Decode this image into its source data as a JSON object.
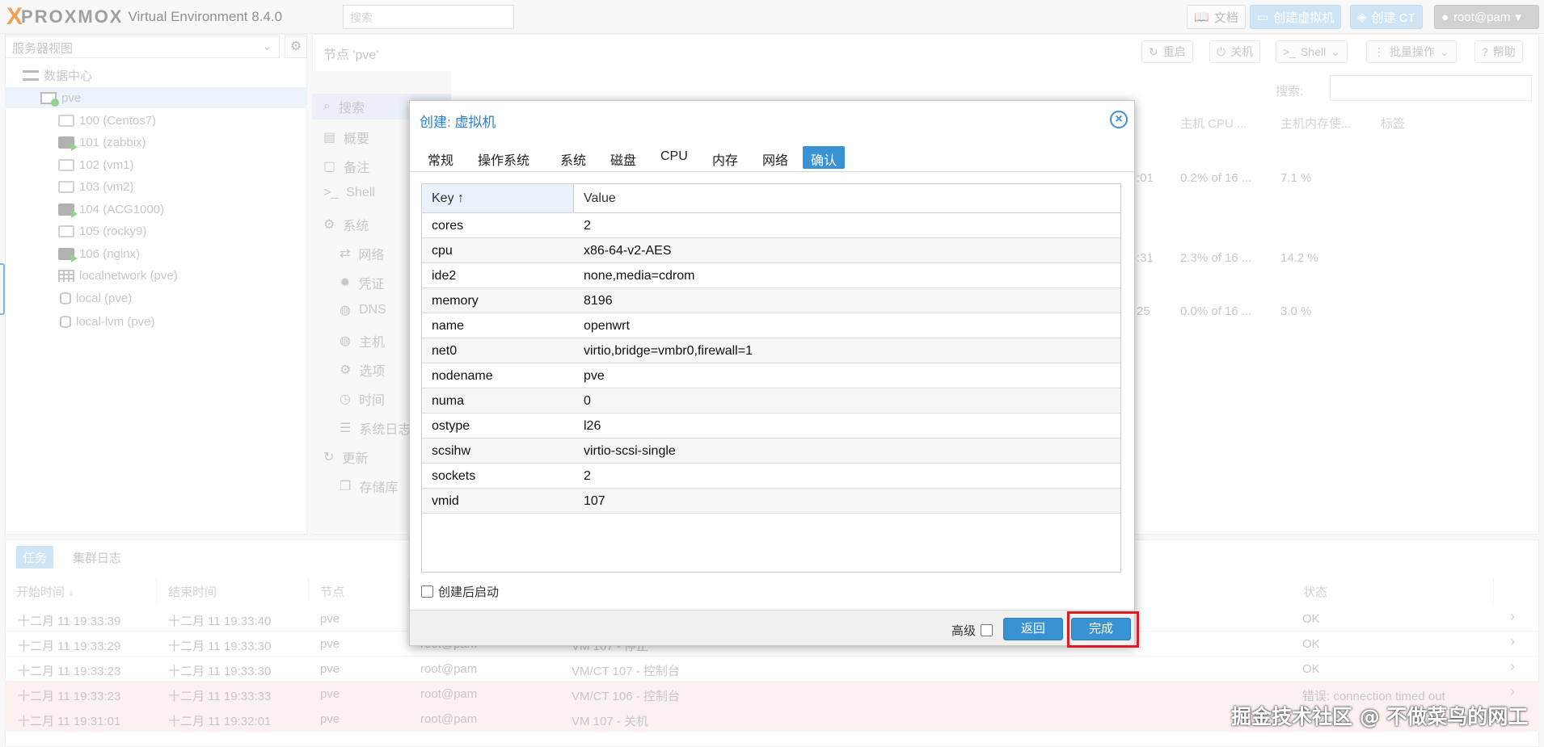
{
  "app": {
    "logo_x": "X",
    "logo_word": "PROXMOX",
    "version": "Virtual Environment 8.4.0",
    "search_placeholder": "搜索",
    "docs_label": "文档",
    "create_vm_label": "创建虚拟机",
    "create_ct_label": "创建 CT",
    "user_label": "root@pam"
  },
  "tree": {
    "view_label": "服务器视图",
    "items": [
      {
        "label": "数据中心",
        "icon": "datacenter-icon"
      },
      {
        "label": "pve",
        "icon": "node-icon"
      },
      {
        "label": "100 (Centos7)",
        "icon": "vm-icon"
      },
      {
        "label": "101 (zabbix)",
        "icon": "vm-running-icon"
      },
      {
        "label": "102 (vm1)",
        "icon": "vm-icon"
      },
      {
        "label": "103 (vm2)",
        "icon": "vm-icon"
      },
      {
        "label": "104 (ACG1000)",
        "icon": "vm-running-icon"
      },
      {
        "label": "105 (rocky9)",
        "icon": "vm-icon"
      },
      {
        "label": "106 (nginx)",
        "icon": "vm-running-icon"
      },
      {
        "label": "localnetwork (pve)",
        "icon": "network-grid-icon"
      },
      {
        "label": "local (pve)",
        "icon": "storage-icon"
      },
      {
        "label": "local-lvm (pve)",
        "icon": "storage-icon"
      }
    ]
  },
  "node": {
    "title": "节点 'pve'",
    "reboot_label": "重启",
    "shutdown_label": "关机",
    "shell_label": "Shell",
    "bulk_label": "批量操作",
    "help_label": "帮助",
    "search_label": "搜索:",
    "nav": [
      {
        "label": "搜索",
        "icon": "search-icon"
      },
      {
        "label": "概要",
        "icon": "summary-icon"
      },
      {
        "label": "备注",
        "icon": "notes-icon"
      },
      {
        "label": "Shell",
        "icon": "terminal-icon"
      },
      {
        "label": "系统",
        "icon": "gears-icon"
      },
      {
        "label": "网络",
        "icon": "network-icon"
      },
      {
        "label": "凭证",
        "icon": "certificate-icon"
      },
      {
        "label": "DNS",
        "icon": "globe-icon"
      },
      {
        "label": "主机",
        "icon": "globe-icon"
      },
      {
        "label": "选项",
        "icon": "gear-icon"
      },
      {
        "label": "时间",
        "icon": "clock-icon"
      },
      {
        "label": "系统日志",
        "icon": "list-icon"
      },
      {
        "label": "更新",
        "icon": "refresh-icon"
      },
      {
        "label": "存储库",
        "icon": "repository-icon"
      }
    ],
    "grid_headers": {
      "cpu": "主机 CPU ...",
      "mem": "主机内存使...",
      "tags": "标签"
    },
    "grid_rows": [
      {
        "uptime": ":01",
        "cpu": "0.2% of 16 ...",
        "mem": "7.1 %"
      },
      {
        "uptime": ":31",
        "cpu": "2.3% of 16 ...",
        "mem": "14.2 %"
      },
      {
        "uptime": "25",
        "cpu": "0.0% of 16 ...",
        "mem": "3.0 %"
      }
    ]
  },
  "tasks": {
    "tab_tasks": "任务",
    "tab_cluster_log": "集群日志",
    "headers": {
      "start": "开始时间",
      "end": "结束时间",
      "node": "节点",
      "status": "状态"
    },
    "rows": [
      {
        "start": "十二月 11 19:33:39",
        "end": "十二月 11 19:33:40",
        "node": "pve",
        "user": "",
        "desc": "",
        "status": "OK",
        "error": false
      },
      {
        "start": "十二月 11 19:33:29",
        "end": "十二月 11 19:33:30",
        "node": "pve",
        "user": "root@pam",
        "desc": "VM 107 - 停止",
        "status": "OK",
        "error": false
      },
      {
        "start": "十二月 11 19:33:23",
        "end": "十二月 11 19:33:30",
        "node": "pve",
        "user": "root@pam",
        "desc": "VM/CT 107 - 控制台",
        "status": "OK",
        "error": false
      },
      {
        "start": "十二月 11 19:33:23",
        "end": "十二月 11 19:33:33",
        "node": "pve",
        "user": "root@pam",
        "desc": "VM/CT 106 - 控制台",
        "status": "错误: connection timed out",
        "error": true
      },
      {
        "start": "十二月 11 19:31:01",
        "end": "十二月 11 19:32:01",
        "node": "pve",
        "user": "root@pam",
        "desc": "VM 107 - 关机",
        "status": "",
        "error": true
      }
    ]
  },
  "dialog": {
    "title": "创建: 虚拟机",
    "tabs": [
      "常规",
      "操作系统",
      "系统",
      "磁盘",
      "CPU",
      "内存",
      "网络",
      "确认"
    ],
    "active_tab": "确认",
    "key_header": "Key ↑",
    "value_header": "Value",
    "rows": [
      {
        "key": "cores",
        "value": "2"
      },
      {
        "key": "cpu",
        "value": "x86-64-v2-AES"
      },
      {
        "key": "ide2",
        "value": "none,media=cdrom"
      },
      {
        "key": "memory",
        "value": "8196"
      },
      {
        "key": "name",
        "value": "openwrt"
      },
      {
        "key": "net0",
        "value": "virtio,bridge=vmbr0,firewall=1"
      },
      {
        "key": "nodename",
        "value": "pve"
      },
      {
        "key": "numa",
        "value": "0"
      },
      {
        "key": "ostype",
        "value": "l26"
      },
      {
        "key": "scsihw",
        "value": "virtio-scsi-single"
      },
      {
        "key": "sockets",
        "value": "2"
      },
      {
        "key": "vmid",
        "value": "107"
      }
    ],
    "start_after_create": "创建后启动",
    "advanced": "高级",
    "back": "返回",
    "finish": "完成"
  },
  "watermark": "掘金技术社区 @ 不做菜鸟的网工",
  "colors": {
    "accent": "#3892d4",
    "brand": "#e57000",
    "highlight": "#e01b24"
  }
}
